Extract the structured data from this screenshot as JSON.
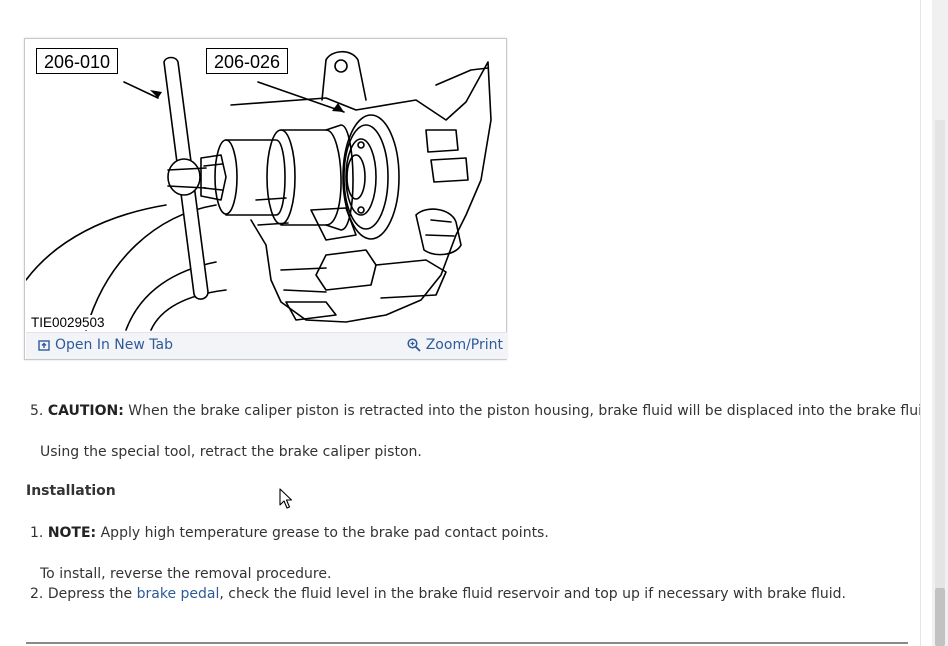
{
  "figure": {
    "callouts": [
      "206-010",
      "206-026"
    ],
    "image_id": "TIE0029503",
    "open_in_new_tab": "Open In New Tab",
    "zoom_print": "Zoom/Print"
  },
  "steps": {
    "step5": {
      "number": "5.",
      "caution_label": "CAUTION:",
      "caution_text": " When the brake caliper piston is retracted into the piston housing, brake fluid will be displaced into the brake fluid reservoir.",
      "instruction": "Using the special tool, retract the brake caliper piston."
    }
  },
  "installation": {
    "heading": "Installation",
    "step1": {
      "number": "1.",
      "note_label": "NOTE:",
      "note_text": " Apply high temperature grease to the brake pad contact points.",
      "instruction": "To install, reverse the removal procedure."
    },
    "step2": {
      "number": "2.",
      "text_before": "Depress the ",
      "link_text": "brake pedal",
      "text_after": ", check the fluid level in the brake fluid reservoir and top up if necessary with brake fluid."
    }
  },
  "colors": {
    "link": "#2e5a9a",
    "text": "#333333",
    "figure_bar": "#f2f4f8"
  },
  "icons": {
    "open_tab": "open-new-tab-icon",
    "zoom": "magnifier-zoom-icon",
    "cursor": "mouse-pointer-icon"
  }
}
